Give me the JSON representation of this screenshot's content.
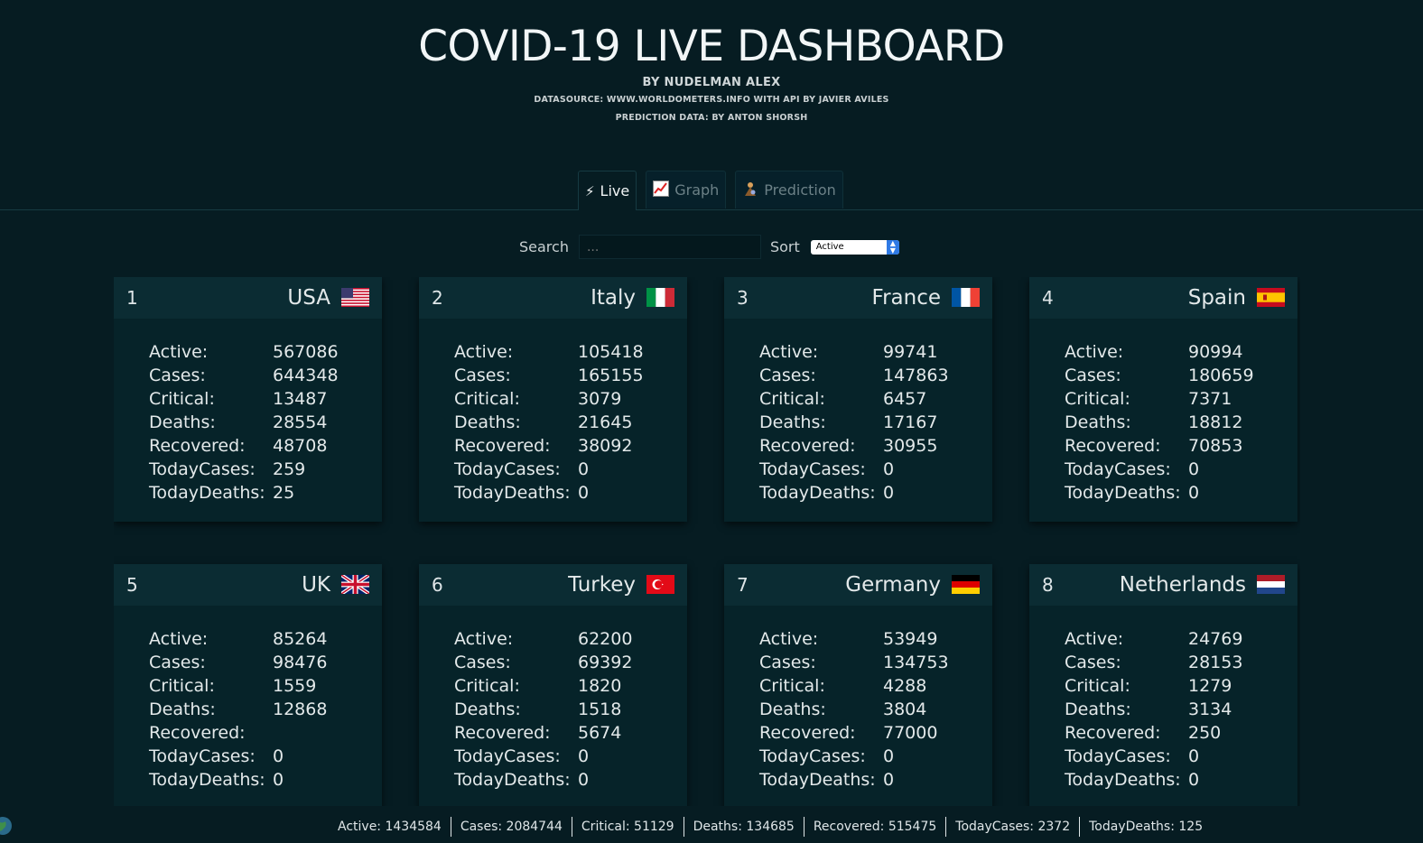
{
  "header": {
    "title": "COVID-19 LIVE DASHBOARD",
    "author": "BY NUDELMAN ALEX",
    "datasource": "DATASOURCE: WWW.WORLDOMETERS.INFO WITH API BY JAVIER AVILES",
    "prediction": "PREDICTION DATA: BY ANTON SHORSH"
  },
  "tabs": [
    {
      "label": "Live",
      "icon": "lightning-icon"
    },
    {
      "label": "Graph",
      "icon": "chart-icon"
    },
    {
      "label": "Prediction",
      "icon": "fortune-teller-icon"
    }
  ],
  "controls": {
    "search_label": "Search",
    "search_placeholder": "...",
    "sort_label": "Sort",
    "sort_value": "Active"
  },
  "stat_labels": [
    "Active:",
    "Cases:",
    "Critical:",
    "Deaths:",
    "Recovered:",
    "TodayCases:",
    "TodayDeaths:"
  ],
  "countries": [
    {
      "rank": "1",
      "name": "USA",
      "flag": "usa-flag-icon",
      "values": [
        "567086",
        "644348",
        "13487",
        "28554",
        "48708",
        "259",
        "25"
      ]
    },
    {
      "rank": "2",
      "name": "Italy",
      "flag": "italy-flag-icon",
      "values": [
        "105418",
        "165155",
        "3079",
        "21645",
        "38092",
        "0",
        "0"
      ]
    },
    {
      "rank": "3",
      "name": "France",
      "flag": "france-flag-icon",
      "values": [
        "99741",
        "147863",
        "6457",
        "17167",
        "30955",
        "0",
        "0"
      ]
    },
    {
      "rank": "4",
      "name": "Spain",
      "flag": "spain-flag-icon",
      "values": [
        "90994",
        "180659",
        "7371",
        "18812",
        "70853",
        "0",
        "0"
      ]
    },
    {
      "rank": "5",
      "name": "UK",
      "flag": "uk-flag-icon",
      "values": [
        "85264",
        "98476",
        "1559",
        "12868",
        "",
        "0",
        "0"
      ]
    },
    {
      "rank": "6",
      "name": "Turkey",
      "flag": "turkey-flag-icon",
      "values": [
        "62200",
        "69392",
        "1820",
        "1518",
        "5674",
        "0",
        "0"
      ]
    },
    {
      "rank": "7",
      "name": "Germany",
      "flag": "germany-flag-icon",
      "values": [
        "53949",
        "134753",
        "4288",
        "3804",
        "77000",
        "0",
        "0"
      ]
    },
    {
      "rank": "8",
      "name": "Netherlands",
      "flag": "netherlands-flag-icon",
      "values": [
        "24769",
        "28153",
        "1279",
        "3134",
        "250",
        "0",
        "0"
      ]
    }
  ],
  "totals": [
    "Active: 1434584",
    "Cases: 2084744",
    "Critical: 51129",
    "Deaths: 134685",
    "Recovered: 515475",
    "TodayCases: 2372",
    "TodayDeaths: 125"
  ],
  "colors": {
    "background": "#061c22",
    "card": "#062329",
    "card_header": "#0b2c33"
  }
}
